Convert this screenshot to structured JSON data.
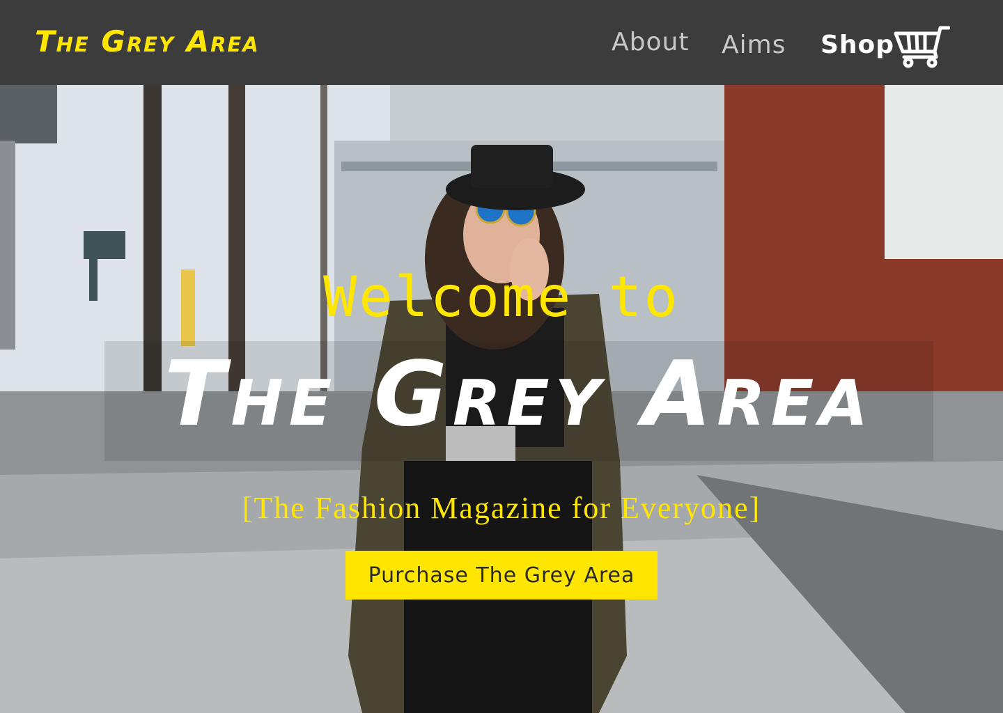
{
  "header": {
    "logo": "The Grey Area",
    "nav": {
      "about": "About",
      "aims": "Aims",
      "shop": "Shop"
    },
    "icons": {
      "cart": "shopping-cart-icon"
    }
  },
  "hero": {
    "welcome": "Welcome to",
    "title": "The Grey Area",
    "tagline": "[The Fashion Magazine for Everyone]",
    "cta_label": "Purchase The Grey Area"
  },
  "colors": {
    "accent": "#ffe600",
    "header_bg": "#3c3c3c",
    "nav_text": "#c9c9c9",
    "nav_active": "#ffffff"
  }
}
